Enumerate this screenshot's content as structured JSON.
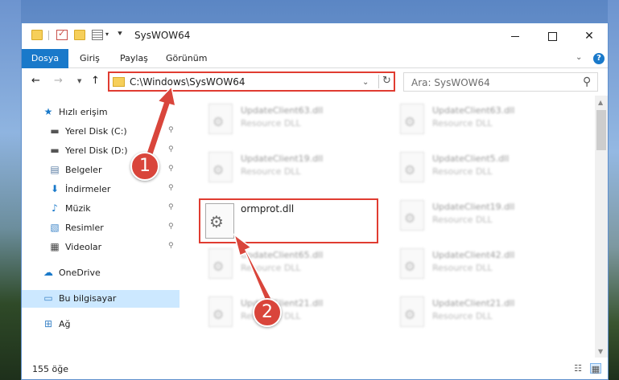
{
  "window": {
    "title": "SysWOW64",
    "minimize_glyph": "",
    "maximize_glyph": "",
    "close_glyph": "✕"
  },
  "ribbon": {
    "tabs": [
      "Dosya",
      "Giriş",
      "Paylaş",
      "Görünüm"
    ],
    "help_glyph": "?"
  },
  "nav": {
    "back_glyph": "←",
    "forward_glyph": "→",
    "up_glyph": "↑",
    "address": "C:\\Windows\\SysWOW64",
    "refresh_glyph": "↻",
    "search_placeholder": "Ara: SysWOW64",
    "search_glyph": "⚲"
  },
  "sidebar": {
    "items": [
      {
        "label": "Hızlı erişim",
        "icon": "star-icon",
        "glyph": "★",
        "color": "#1979ca",
        "pinned": false
      },
      {
        "label": "Yerel Disk (C:)",
        "icon": "drive-icon",
        "glyph": "▬",
        "color": "#555555",
        "pinned": true
      },
      {
        "label": "Yerel Disk (D:)",
        "icon": "drive-icon",
        "glyph": "▬",
        "color": "#555555",
        "pinned": true
      },
      {
        "label": "Belgeler",
        "icon": "documents-icon",
        "glyph": "▤",
        "color": "#5d7fa5",
        "pinned": true
      },
      {
        "label": "İndirmeler",
        "icon": "download-icon",
        "glyph": "⬇",
        "color": "#1979ca",
        "pinned": true
      },
      {
        "label": "Müzik",
        "icon": "music-icon",
        "glyph": "♪",
        "color": "#1979ca",
        "pinned": true
      },
      {
        "label": "Resimler",
        "icon": "pictures-icon",
        "glyph": "▧",
        "color": "#3f86c8",
        "pinned": true
      },
      {
        "label": "Videolar",
        "icon": "videos-icon",
        "glyph": "▦",
        "color": "#444444",
        "pinned": true
      },
      {
        "label": "OneDrive",
        "icon": "cloud-icon",
        "glyph": "☁",
        "color": "#1979ca",
        "pinned": false
      },
      {
        "label": "Bu bilgisayar",
        "icon": "computer-icon",
        "glyph": "▭",
        "color": "#3f86c8",
        "pinned": false,
        "selected": true
      },
      {
        "label": "Ağ",
        "icon": "network-icon",
        "glyph": "⊞",
        "color": "#3f86c8",
        "pinned": false
      }
    ],
    "pin_glyph": "📌"
  },
  "files": {
    "focused": {
      "name": "ormprot.dll"
    },
    "tiles": [
      {
        "name": "UpdateClient63.dll",
        "type": "Resource DLL"
      },
      {
        "name": "UpdateClient63.dll",
        "type": "Resource DLL"
      },
      {
        "name": "UpdateClient19.dll",
        "type": "Resource DLL"
      },
      {
        "name": "UpdateClient5.dll",
        "type": "Resource DLL"
      },
      {
        "name": "UpdateClient19.dll",
        "type": "Resource DLL"
      },
      {
        "name": "UpdateClient65.dll",
        "type": "Resource DLL"
      },
      {
        "name": "UpdateClient42.dll",
        "type": "Resource DLL"
      },
      {
        "name": "UpdateClient21.dll",
        "type": "Resource DLL"
      },
      {
        "name": "UpdateClient21.dll",
        "type": "Resource DLL"
      }
    ]
  },
  "status": {
    "count": "155 öğe"
  },
  "callouts": [
    "1",
    "2"
  ],
  "colors": {
    "accent": "#1979ca",
    "highlight": "#e03c31",
    "selection": "#cce8ff"
  }
}
